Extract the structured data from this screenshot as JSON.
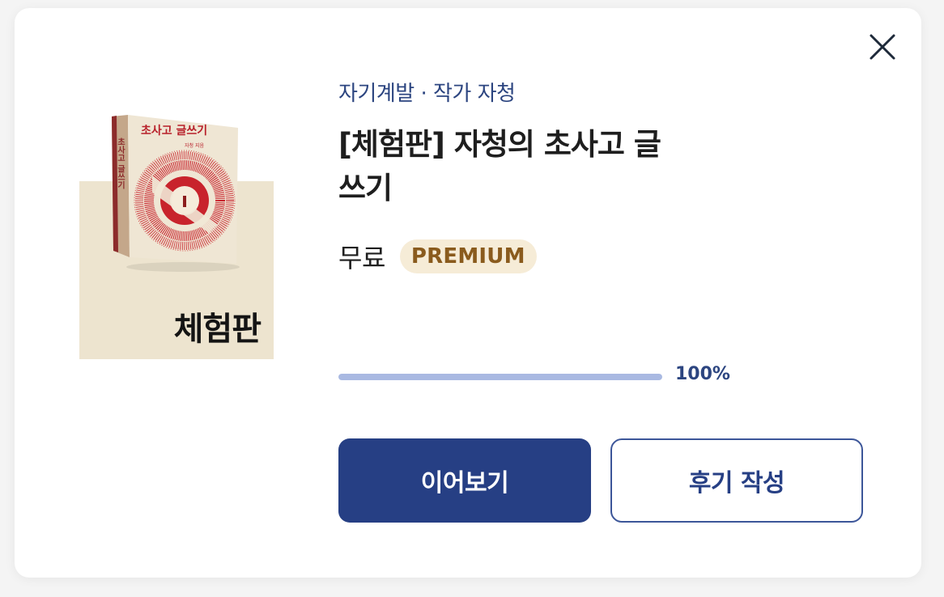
{
  "dialog": {
    "close_icon": "close-icon"
  },
  "cover": {
    "book_title": "초사고 글쓰기",
    "book_author": "자청 지음",
    "badge": "체험판",
    "colors": {
      "background": "#ede4cf",
      "accent": "#c8232c"
    }
  },
  "book": {
    "category": "자기계발 · 작가 자청",
    "title": "[체험판] 자청의 초사고 글쓰기",
    "price": "무료",
    "premium_badge": "PREMIUM"
  },
  "progress": {
    "value": 100,
    "label": "100%"
  },
  "actions": {
    "continue_label": "이어보기",
    "review_label": "후기 작성"
  },
  "colors": {
    "primary": "#263f84",
    "category_text": "#2c4580",
    "premium_bg": "#f6ecd7",
    "premium_text": "#8a5b1d",
    "progress_fill": "#a9b9e2"
  }
}
